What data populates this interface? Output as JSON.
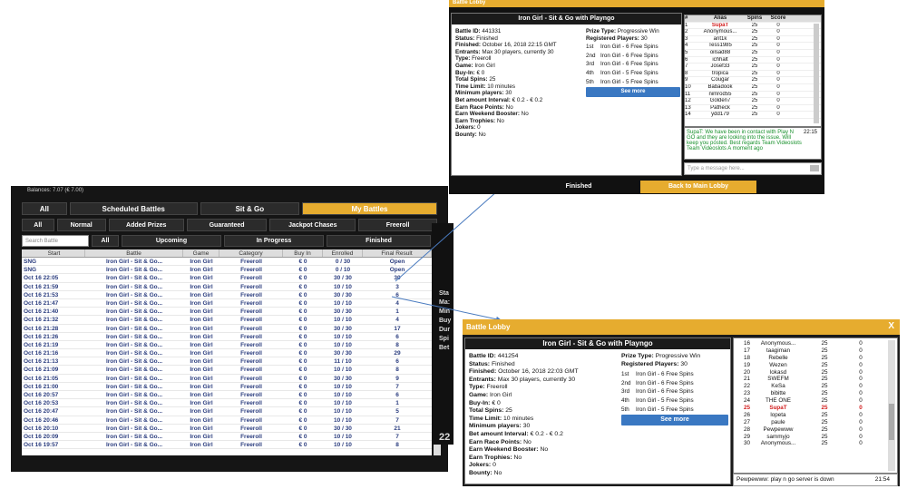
{
  "lobby": {
    "caption": "Balances: 7.07 (€ 7.00)",
    "tabs1": [
      {
        "label": "All",
        "active": false
      },
      {
        "label": "Scheduled Battles",
        "active": false
      },
      {
        "label": "Sit & Go",
        "active": false
      },
      {
        "label": "My Battles",
        "active": true
      }
    ],
    "tabs2": [
      "All",
      "Normal",
      "Added Prizes",
      "Guaranteed",
      "Jackpot Chases",
      "Freeroll"
    ],
    "search_placeholder": "Search Battle",
    "tabs3": [
      "All",
      "Upcoming",
      "In Progress",
      "Finished"
    ],
    "columns": [
      "Start",
      "Battle",
      "Game",
      "Category",
      "Buy In",
      "Enrolled",
      "Final Result"
    ],
    "rows": [
      [
        "SNG",
        "Iron Girl - Sit & Go...",
        "Iron Girl",
        "Freeroll",
        "€ 0",
        "0 / 30",
        "Open"
      ],
      [
        "SNG",
        "Iron Girl - Sit & Go...",
        "Iron Girl",
        "Freeroll",
        "€ 0",
        "0 / 10",
        "Open"
      ],
      [
        "Oct 16 22:05",
        "Iron Girl - Sit & Go...",
        "Iron Girl",
        "Freeroll",
        "€ 0",
        "30 / 30",
        "30"
      ],
      [
        "Oct 16 21:59",
        "Iron Girl - Sit & Go...",
        "Iron Girl",
        "Freeroll",
        "€ 0",
        "10 / 10",
        "3"
      ],
      [
        "Oct 16 21:53",
        "Iron Girl - Sit & Go...",
        "Iron Girl",
        "Freeroll",
        "€ 0",
        "30 / 30",
        "6"
      ],
      [
        "Oct 16 21:47",
        "Iron Girl - Sit & Go...",
        "Iron Girl",
        "Freeroll",
        "€ 0",
        "10 / 10",
        "4"
      ],
      [
        "Oct 16 21:40",
        "Iron Girl - Sit & Go...",
        "Iron Girl",
        "Freeroll",
        "€ 0",
        "30 / 30",
        "1"
      ],
      [
        "Oct 16 21:32",
        "Iron Girl - Sit & Go...",
        "Iron Girl",
        "Freeroll",
        "€ 0",
        "10 / 10",
        "4"
      ],
      [
        "Oct 16 21:28",
        "Iron Girl - Sit & Go...",
        "Iron Girl",
        "Freeroll",
        "€ 0",
        "30 / 30",
        "17"
      ],
      [
        "Oct 16 21:26",
        "Iron Girl - Sit & Go...",
        "Iron Girl",
        "Freeroll",
        "€ 0",
        "10 / 10",
        "6"
      ],
      [
        "Oct 16 21:19",
        "Iron Girl - Sit & Go...",
        "Iron Girl",
        "Freeroll",
        "€ 0",
        "10 / 10",
        "8"
      ],
      [
        "Oct 16 21:16",
        "Iron Girl - Sit & Go...",
        "Iron Girl",
        "Freeroll",
        "€ 0",
        "30 / 30",
        "29"
      ],
      [
        "Oct 16 21:13",
        "Iron Girl - Sit & Go...",
        "Iron Girl",
        "Freeroll",
        "€ 0",
        "11 / 10",
        "6"
      ],
      [
        "Oct 16 21:09",
        "Iron Girl - Sit & Go...",
        "Iron Girl",
        "Freeroll",
        "€ 0",
        "10 / 10",
        "8"
      ],
      [
        "Oct 16 21:05",
        "Iron Girl - Sit & Go...",
        "Iron Girl",
        "Freeroll",
        "€ 0",
        "30 / 30",
        "9"
      ],
      [
        "Oct 16 21:00",
        "Iron Girl - Sit & Go...",
        "Iron Girl",
        "Freeroll",
        "€ 0",
        "10 / 10",
        "7"
      ],
      [
        "Oct 16 20:57",
        "Iron Girl - Sit & Go...",
        "Iron Girl",
        "Freeroll",
        "€ 0",
        "10 / 10",
        "6"
      ],
      [
        "Oct 16 20:53",
        "Iron Girl - Sit & Go...",
        "Iron Girl",
        "Freeroll",
        "€ 0",
        "10 / 10",
        "1"
      ],
      [
        "Oct 16 20:47",
        "Iron Girl - Sit & Go...",
        "Iron Girl",
        "Freeroll",
        "€ 0",
        "10 / 10",
        "5"
      ],
      [
        "Oct 16 20:46",
        "Iron Girl - Sit & Go...",
        "Iron Girl",
        "Freeroll",
        "€ 0",
        "10 / 10",
        "7"
      ],
      [
        "Oct 16 20:10",
        "Iron Girl - Sit & Go...",
        "Iron Girl",
        "Freeroll",
        "€ 0",
        "30 / 30",
        "21"
      ],
      [
        "Oct 16 20:09",
        "Iron Girl - Sit & Go...",
        "Iron Girl",
        "Freeroll",
        "€ 0",
        "10 / 10",
        "7"
      ],
      [
        "Oct 16 19:57",
        "Iron Girl - Sit & Go...",
        "Iron Girl",
        "Freeroll",
        "€ 0",
        "10 / 10",
        "8"
      ]
    ],
    "side_labels": [
      "Sta",
      "Ma:",
      "Min",
      "Buy",
      "Dur",
      "Spi",
      "Bet"
    ],
    "side_number": "22"
  },
  "popup_top": {
    "window_title": "Battle Lobby",
    "title": "Iron Girl - Sit & Go with Playngo",
    "details": [
      [
        "Battle ID:",
        "441331"
      ],
      [
        "Status:",
        "Finished"
      ],
      [
        "Finished:",
        "October 16, 2018 22:15 GMT"
      ],
      [
        "Entrants:",
        "Max 30 players, currently 30"
      ],
      [
        "Type:",
        "Freeroll"
      ],
      [
        "Game:",
        "Iron Girl"
      ],
      [
        "Buy-In:",
        "€ 0"
      ],
      [
        "Total Spins:",
        "25"
      ],
      [
        "Time Limit:",
        "10 minutes"
      ],
      [
        "Minimum players:",
        "30"
      ],
      [
        "Bet amount Interval:",
        "€ 0.2 - € 0.2"
      ],
      [
        "Earn Race Points:",
        "No"
      ],
      [
        "Earn Weekend Booster:",
        "No"
      ],
      [
        "Earn Trophies:",
        "No"
      ],
      [
        "Jokers:",
        "0"
      ],
      [
        "Bounty:",
        "No"
      ]
    ],
    "prize_type_label": "Prize Type:",
    "prize_type": "Progressive Win",
    "registered_label": "Registered Players:",
    "registered": "30",
    "prizes": [
      [
        "1st",
        "Iron Girl - 6 Free Spins"
      ],
      [
        "2nd",
        "Iron Girl - 6 Free Spins"
      ],
      [
        "3rd",
        "Iron Girl - 6 Free Spins"
      ],
      [
        "4th",
        "Iron Girl - 5 Free Spins"
      ],
      [
        "5th",
        "Iron Girl - 5 Free Spins"
      ]
    ],
    "see_more": "See more",
    "table_header": [
      "#",
      "Alias",
      "Spins",
      "Score"
    ],
    "players": [
      [
        "1",
        "SupaT",
        "25",
        "0"
      ],
      [
        "2",
        "Anonymous...",
        "25",
        "0"
      ],
      [
        "3",
        "ant1k",
        "25",
        "0"
      ],
      [
        "4",
        "Tess1985",
        "25",
        "0"
      ],
      [
        "5",
        "oilsad88",
        "25",
        "0"
      ],
      [
        "6",
        "ichhalt",
        "25",
        "0"
      ],
      [
        "7",
        "Josef33",
        "25",
        "0"
      ],
      [
        "8",
        "tropica",
        "25",
        "0"
      ],
      [
        "9",
        "Cougar",
        "25",
        "0"
      ],
      [
        "10",
        "Babadook",
        "25",
        "0"
      ],
      [
        "11",
        "nimrod55",
        "25",
        "0"
      ],
      [
        "12",
        "Golden7",
        "25",
        "0"
      ],
      [
        "13",
        "Patheck",
        "25",
        "0"
      ],
      [
        "14",
        "ydd179",
        "25",
        "0"
      ]
    ],
    "chat_text": "SupaT: We have been in contact with Play N GO and they are looking into the issue. Will keep you posted. Best regards Team Videoslots  Team Videoslots  A moment ago",
    "chat_time": "22:15",
    "message_placeholder": "Type a message here...",
    "btn_finished": "Finished",
    "btn_back": "Back to Main Lobby"
  },
  "popup_bottom": {
    "window_title": "Battle Lobby",
    "close": "X",
    "title": "Iron Girl - Sit & Go with Playngo",
    "details": [
      [
        "Battle ID:",
        "441254"
      ],
      [
        "Status:",
        "Finished"
      ],
      [
        "Finished:",
        "October 16, 2018 22:03 GMT"
      ],
      [
        "Entrants:",
        "Max 30 players, currently 30"
      ],
      [
        "Type:",
        "Freeroll"
      ],
      [
        "Game:",
        "Iron Girl"
      ],
      [
        "Buy-In:",
        "€ 0"
      ],
      [
        "Total Spins:",
        "25"
      ],
      [
        "Time Limit:",
        "10 minutes"
      ],
      [
        "Minimum players:",
        "30"
      ],
      [
        "Bet amount Interval:",
        "€ 0.2 - € 0.2"
      ],
      [
        "Earn Race Points:",
        "No"
      ],
      [
        "Earn Weekend Booster:",
        "No"
      ],
      [
        "Earn Trophies:",
        "No"
      ],
      [
        "Jokers:",
        "0"
      ],
      [
        "Bounty:",
        "No"
      ]
    ],
    "prize_type_label": "Prize Type:",
    "prize_type": "Progressive Win",
    "registered_label": "Registered Players:",
    "registered": "30",
    "prizes": [
      [
        "1st",
        "Iron Girl - 6 Free Spins"
      ],
      [
        "2nd",
        "Iron Girl - 6 Free Spins"
      ],
      [
        "3rd",
        "Iron Girl - 6 Free Spins"
      ],
      [
        "4th",
        "Iron Girl - 5 Free Spins"
      ],
      [
        "5th",
        "Iron Girl - 5 Free Spins"
      ]
    ],
    "see_more": "See more",
    "players": [
      [
        "16",
        "Anonymous...",
        "25",
        "0"
      ],
      [
        "17",
        "taagiman",
        "25",
        "0"
      ],
      [
        "18",
        "Rebelle",
        "25",
        "0"
      ],
      [
        "19",
        "Wezen",
        "25",
        "0"
      ],
      [
        "20",
        "lokasd",
        "25",
        "0"
      ],
      [
        "21",
        "SWEFM",
        "25",
        "0"
      ],
      [
        "22",
        "KeSa",
        "25",
        "0"
      ],
      [
        "23",
        "bibitte",
        "25",
        "0"
      ],
      [
        "24",
        "THE ONE",
        "25",
        "0"
      ],
      [
        "25",
        "SupaT",
        "25",
        "0"
      ],
      [
        "26",
        "lopeta",
        "25",
        "0"
      ],
      [
        "27",
        "paule",
        "25",
        "0"
      ],
      [
        "28",
        "Pewpewww",
        "25",
        "0"
      ],
      [
        "29",
        "sammyjo",
        "25",
        "0"
      ],
      [
        "30",
        "Anonymous...",
        "25",
        "0"
      ]
    ],
    "chat_text": "Pewpewww: play n go server is down",
    "chat_time": "21:54"
  },
  "colors": {
    "accent": "#e6ac2f",
    "link": "#2a3c7e",
    "arrow": "#4a7bbf",
    "highlight": "#d21c1c"
  }
}
